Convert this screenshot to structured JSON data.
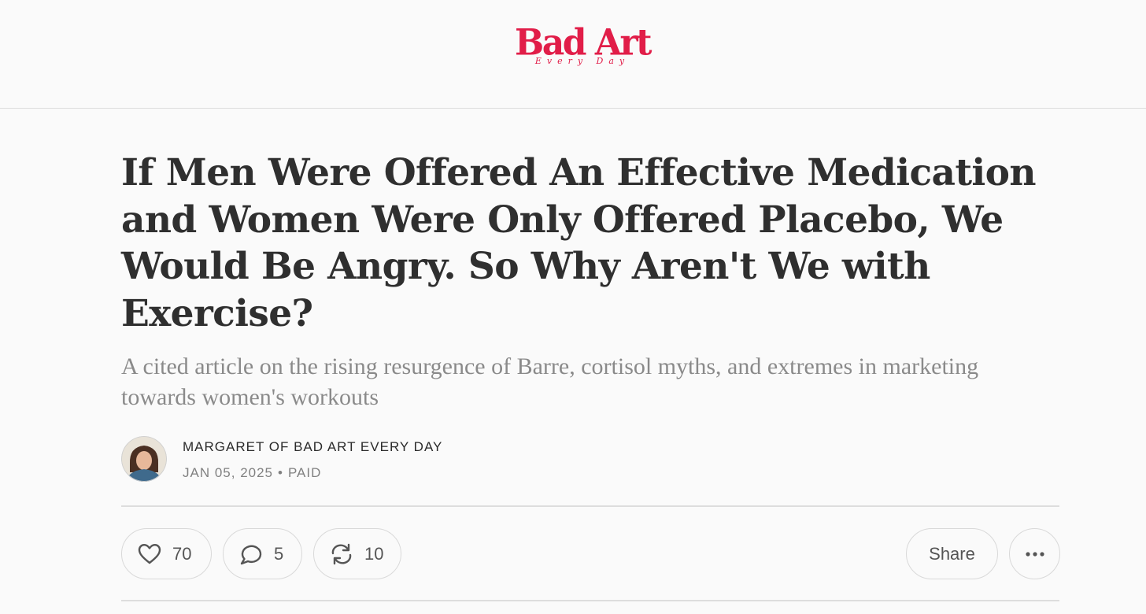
{
  "header": {
    "logo": {
      "main": "Bad Art",
      "sub": "Every Day"
    }
  },
  "article": {
    "title": "If Men Were Offered An Effective Medication and Women Were Only Offered Placebo, We Would Be Angry. So Why Aren't We with Exercise?",
    "subtitle": "A cited article on the rising resurgence of Barre, cortisol myths, and extremes in marketing towards women's workouts",
    "author": "MARGARET OF BAD ART EVERY DAY",
    "date": "JAN 05, 2025",
    "separator": "•",
    "access": "PAID"
  },
  "actions": {
    "likes": "70",
    "comments": "5",
    "restacks": "10",
    "share_label": "Share"
  },
  "icons": {
    "like": "heart-icon",
    "comment": "speech-bubble-icon",
    "restack": "restack-arrows-icon",
    "more": "ellipsis-icon"
  },
  "colors": {
    "brand": "#e11d48",
    "background": "#fafafa",
    "title": "#2f2f2f",
    "muted": "#8a8a8a"
  }
}
